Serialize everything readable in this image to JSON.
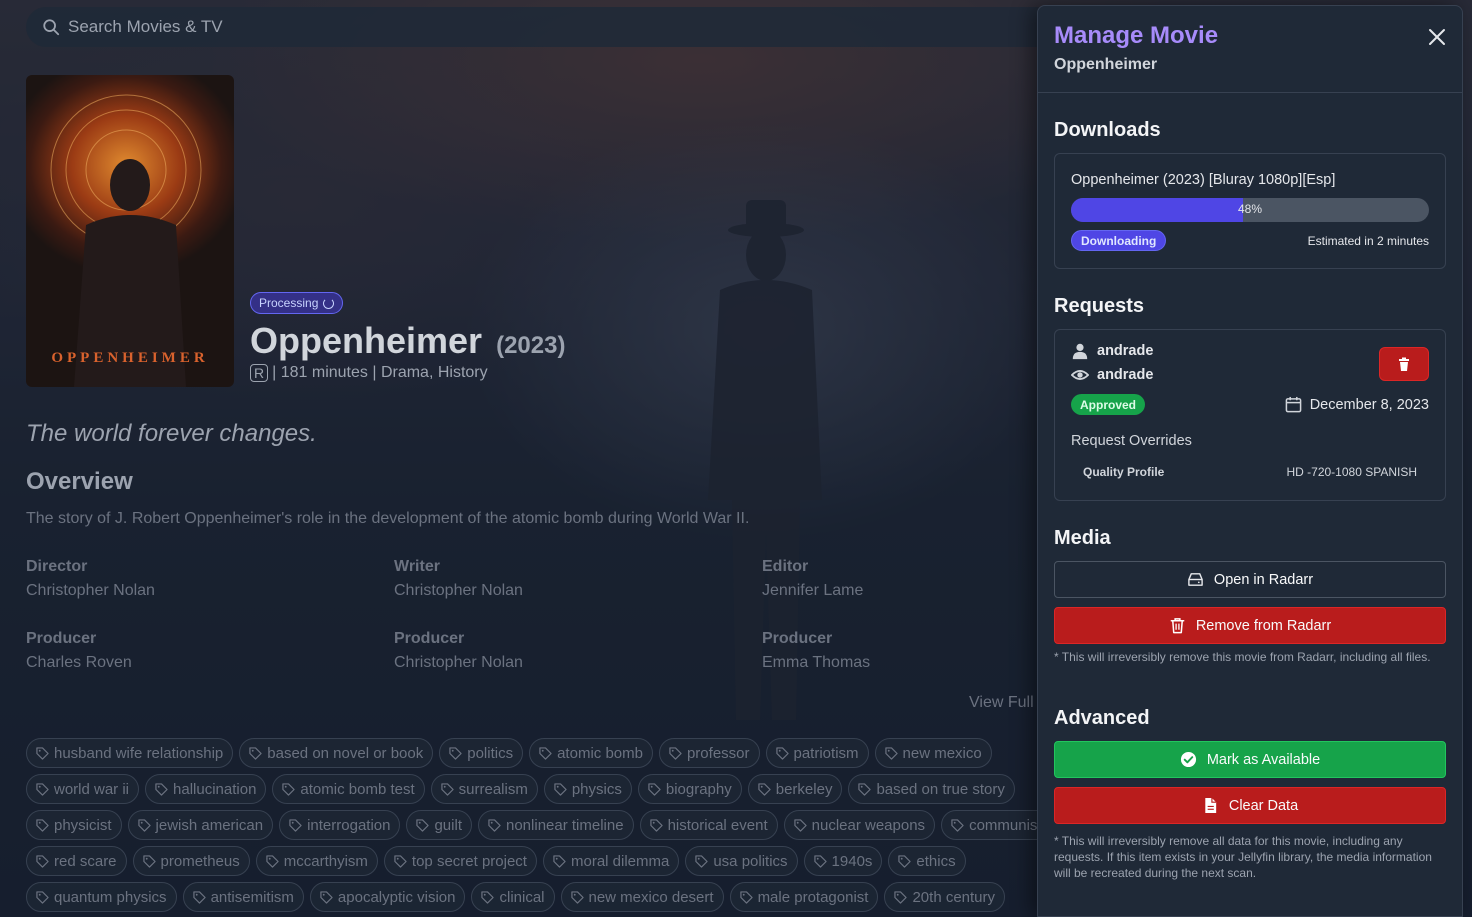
{
  "search": {
    "placeholder": "Search Movies & TV"
  },
  "movie": {
    "poster_text": "OPPENHEIMER",
    "status": "Processing",
    "title": "Oppenheimer",
    "year": "(2023)",
    "rating": "R",
    "meta": "| 181 minutes | Drama, History",
    "tagline": "The world forever changes.",
    "overview_heading": "Overview",
    "overview": "The story of J. Robert Oppenheimer's role in the development of the atomic bomb during World War II.",
    "crew": [
      {
        "job": "Director",
        "name": "Christopher Nolan"
      },
      {
        "job": "Writer",
        "name": "Christopher Nolan"
      },
      {
        "job": "Editor",
        "name": "Jennifer Lame"
      },
      {
        "job": "Producer",
        "name": "Charles Roven"
      },
      {
        "job": "Producer",
        "name": "Christopher Nolan"
      },
      {
        "job": "Producer",
        "name": "Emma Thomas"
      }
    ],
    "view_full": "View Full",
    "keywords": [
      [
        "husband wife relationship",
        "based on novel or book",
        "politics",
        "atomic bomb",
        "professor",
        "patriotism",
        "new mexico"
      ],
      [
        "world war ii",
        "hallucination",
        "atomic bomb test",
        "surrealism",
        "physics",
        "biography",
        "berkeley",
        "based on true story"
      ],
      [
        "physicist",
        "jewish american",
        "interrogation",
        "guilt",
        "nonlinear timeline",
        "historical event",
        "nuclear weapons",
        "communism"
      ],
      [
        "red scare",
        "prometheus",
        "mccarthyism",
        "top secret project",
        "moral dilemma",
        "usa politics",
        "1940s",
        "ethics"
      ],
      [
        "quantum physics",
        "antisemitism",
        "apocalyptic vision",
        "clinical",
        "new mexico desert",
        "male protagonist",
        "20th century"
      ]
    ]
  },
  "panel": {
    "title": "Manage Movie",
    "subtitle": "Oppenheimer",
    "downloads": {
      "heading": "Downloads",
      "item_title": "Oppenheimer (2023) [Bluray 1080p][Esp]",
      "progress_percent": 48,
      "progress_label": "48%",
      "status": "Downloading",
      "eta": "Estimated in 2 minutes"
    },
    "requests": {
      "heading": "Requests",
      "requested_by": "andrade",
      "modified_by": "andrade",
      "status": "Approved",
      "date": "December 8, 2023",
      "overrides_label": "Request Overrides",
      "override_key": "Quality Profile",
      "override_value": "HD -720-1080 SPANISH"
    },
    "media": {
      "heading": "Media",
      "open_label": "Open in Radarr",
      "remove_label": "Remove from Radarr",
      "remove_note": "* This will irreversibly remove this movie from Radarr, including all files."
    },
    "advanced": {
      "heading": "Advanced",
      "available_label": "Mark as Available",
      "clear_label": "Clear Data",
      "clear_note": "* This will irreversibly remove all data for this movie, including any requests. If this item exists in your Jellyfin library, the media information will be recreated during the next scan."
    }
  },
  "colors": {
    "accent_purple": "#a78bfa",
    "progress_indigo": "#4f46e5",
    "danger_red": "#b91c1c",
    "success_green": "#16a34a"
  }
}
